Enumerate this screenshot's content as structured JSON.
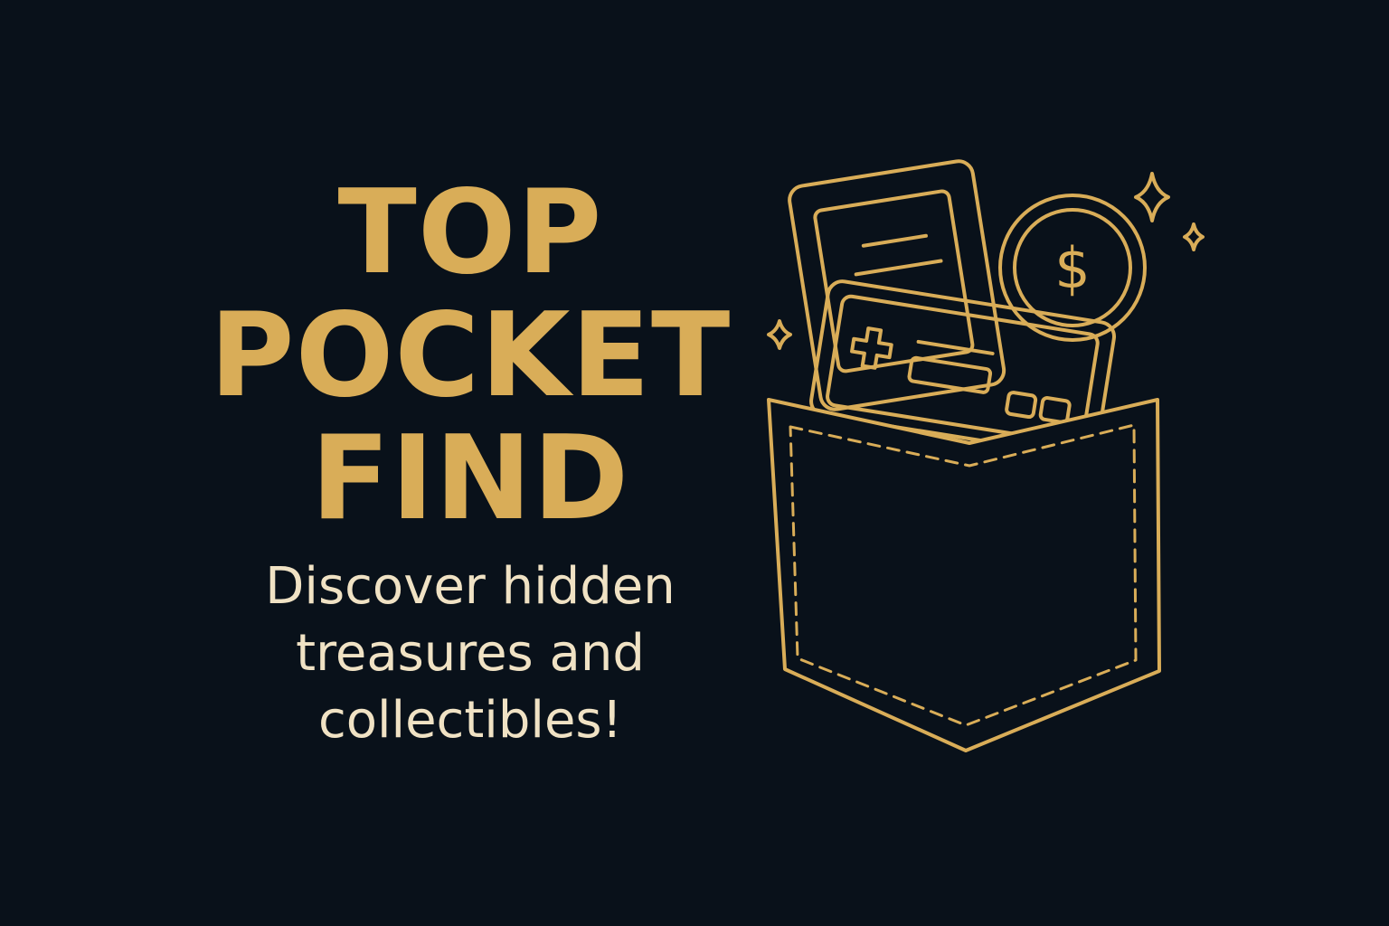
{
  "headline": {
    "line1": "TOP",
    "line2": "POCKET",
    "line3": "FIND"
  },
  "tagline": {
    "line1": "Discover hidden",
    "line2": "treasures and",
    "line3": "collectibles!"
  },
  "illustration": {
    "coin_symbol": "$",
    "icons": [
      "pocket-icon",
      "receipt-card-icon",
      "coin-icon",
      "game-card-icon",
      "sparkle-icon"
    ]
  },
  "colors": {
    "background": "#09111a",
    "accent_gold": "#d9ad58",
    "text_cream": "#f0e2c4"
  }
}
